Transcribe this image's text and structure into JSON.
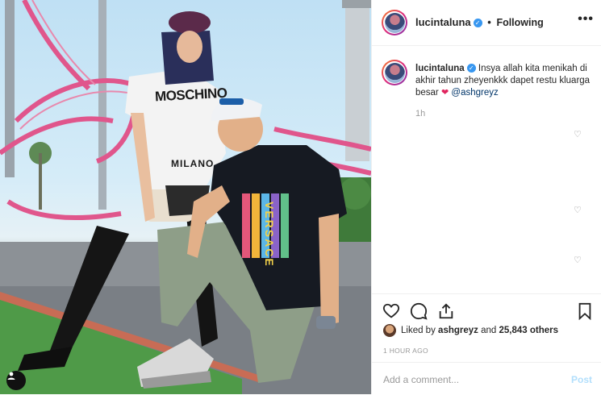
{
  "post": {
    "username": "lucintaluna",
    "follow_status": "Following",
    "separator": "•",
    "more_icon": "more-horizontal-icon",
    "caption_user": "lucintaluna",
    "caption_text": "Insya allah kita menikah di akhir tahun zheyenkkk dapet restu kluarga besar",
    "caption_emoji": "❤",
    "caption_mention": "@ashgreyz",
    "caption_time": "1h",
    "likes_prefix": "Liked by",
    "likes_user": "ashgreyz",
    "likes_and": "and",
    "likes_count": "25,843 others",
    "time_ago": "1 HOUR AGO",
    "comment_placeholder": "Add a comment...",
    "post_button": "Post"
  },
  "photo": {
    "shirt_left_text_1": "MOSCHINO",
    "shirt_left_text_2": "MILANO",
    "shirt_right_text": "VERSACE"
  },
  "colors": {
    "verified": "#3897f0",
    "coaster": "#e0568c",
    "post_disabled": "#b2dffc"
  }
}
